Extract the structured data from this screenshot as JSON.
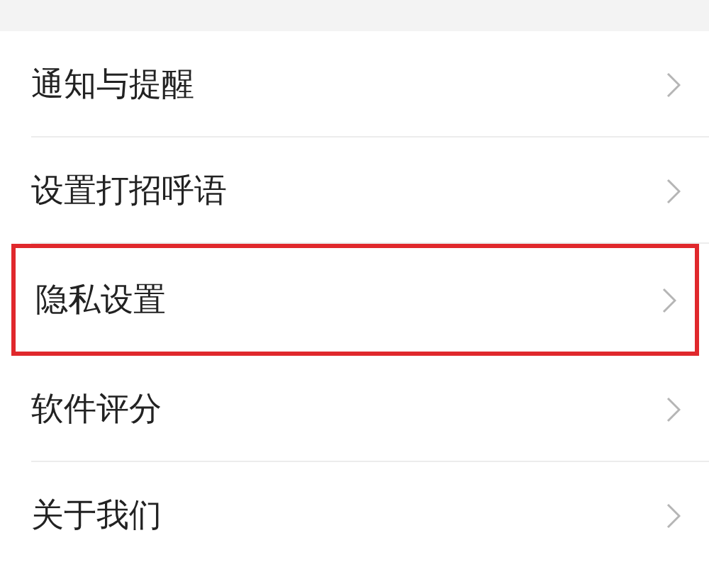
{
  "menu": {
    "items": [
      {
        "label": "通知与提醒",
        "highlighted": false
      },
      {
        "label": "设置打招呼语",
        "highlighted": false
      },
      {
        "label": "隐私设置",
        "highlighted": true
      },
      {
        "label": "软件评分",
        "highlighted": false
      },
      {
        "label": "关于我们",
        "highlighted": false
      }
    ]
  }
}
